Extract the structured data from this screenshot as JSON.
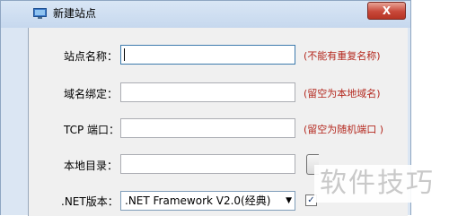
{
  "window": {
    "title": "新建站点",
    "close_label": "X"
  },
  "form": {
    "site_name_label": "站点名称：",
    "site_name_value": "",
    "site_name_hint": "(不能有重复名称)",
    "domain_label": "域名绑定：",
    "domain_value": "",
    "domain_hint": "(留空为本地域名)",
    "port_label": "TCP 端口：",
    "port_value": "",
    "port_hint": "(留空为随机端口 )",
    "dir_label": "本地目录：",
    "dir_value": "",
    "net_label": ".NET版本：",
    "net_selected": ".NET Framework V2.0(经典)",
    "checkbox_mark": "✓"
  },
  "watermark": {
    "text": "软件技巧"
  },
  "colors": {
    "hint_red": "#b4281e",
    "titlebar_blue": "#c6d8ee"
  }
}
